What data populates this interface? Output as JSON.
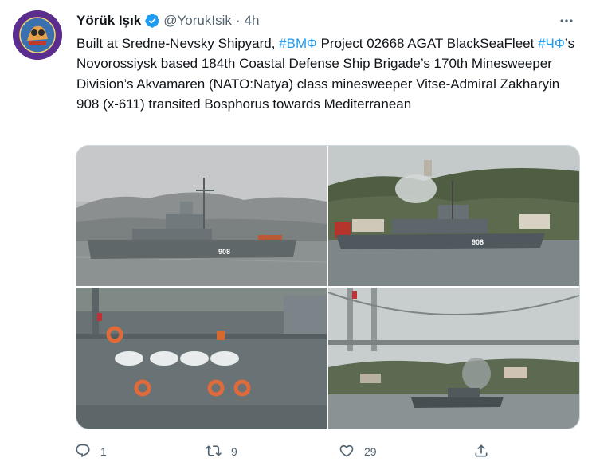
{
  "author": {
    "name": "Yörük Işık",
    "handle": "@YorukIsik",
    "separator": "·",
    "time": "4h"
  },
  "tweet": {
    "segments": [
      "Built at Sredne-Nevsky Shipyard, ",
      "#ВМФ",
      " Project 02668 AGAT BlackSeaFleet ",
      "#ЧФ",
      "’s Novorossiysk based 184th Coastal Defense Ship Brigade’s 170th Minesweeper Division’s Akvamaren (NATO:Natya) class minesweeper Vitse-Admiral Zakharyin 908 (x-611) transited Bosphorus towards Mediterranean"
    ]
  },
  "photos": {
    "hull_number": "908"
  },
  "actions": {
    "reply_count": "1",
    "retweet_count": "9",
    "like_count": "29"
  },
  "colors": {
    "text": "#0f1419",
    "secondary": "#536471",
    "link": "#1d9bf0",
    "verified": "#1d9bf0",
    "border": "#cfd9de"
  },
  "icons": [
    "verified-badge-icon",
    "more-options-icon",
    "reply-icon",
    "retweet-icon",
    "like-icon",
    "share-icon"
  ]
}
